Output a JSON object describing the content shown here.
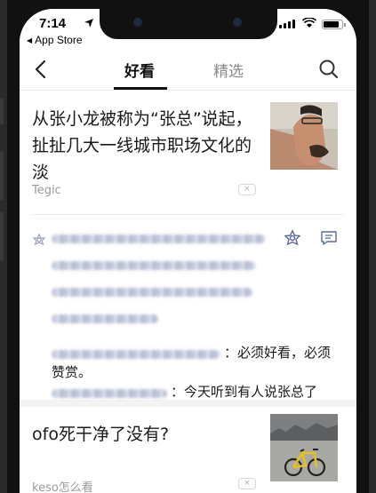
{
  "status_bar": {
    "time": "7:14",
    "back_app": "App Store"
  },
  "nav": {
    "tab_active": "好看",
    "tab_inactive": "精选"
  },
  "articles": [
    {
      "title": "从张小龙被称为“张总”说起，扯扯几大一线城市职场文化的淡",
      "source": "Tegic",
      "dismiss": "×"
    },
    {
      "title": "ofo死干净了没有?",
      "source": "keso怎么看",
      "dismiss": "×"
    }
  ],
  "comments": {
    "line1_suffix": "：必须好看，必须",
    "line2": "赞赏。",
    "line3_suffix": "：今天听到有人说张总了"
  },
  "colors": {
    "accent": "#111111",
    "inactive_tab": "#8a8a8a",
    "source_text": "#9a9a9a",
    "icon_blue": "#5a6a9a"
  },
  "icons": [
    "back-chevron-icon",
    "search-icon",
    "flower-icon",
    "comment-icon",
    "close-icon",
    "location-arrow-icon",
    "signal-icon",
    "wifi-icon",
    "battery-icon"
  ]
}
